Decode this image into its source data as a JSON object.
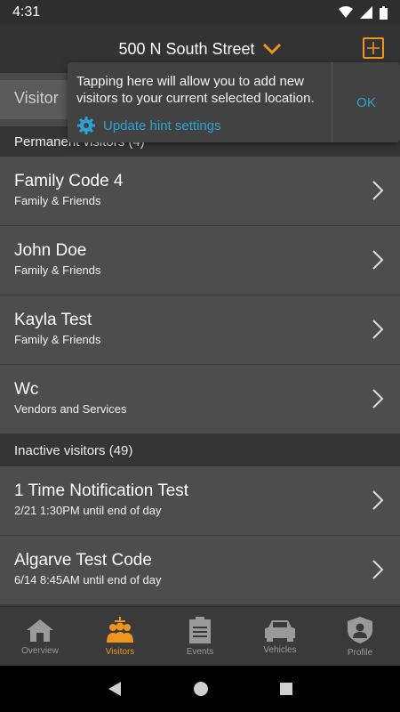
{
  "status": {
    "time": "4:31"
  },
  "header": {
    "location": "500 N South Street"
  },
  "search": {
    "placeholder_partial": "Visitor"
  },
  "tooltip": {
    "text": "Tapping here will allow you to add new visitors to your current selected location.",
    "link": "Update hint settings",
    "ok": "OK"
  },
  "sections": {
    "permanent": "Permanent visitors (4)",
    "inactive": "Inactive visitors (49)"
  },
  "permanent_rows": [
    {
      "title": "Family Code 4",
      "subtitle": "Family & Friends"
    },
    {
      "title": "John Doe",
      "subtitle": "Family & Friends"
    },
    {
      "title": "Kayla Test",
      "subtitle": "Family & Friends"
    },
    {
      "title": "Wc",
      "subtitle": "Vendors and Services"
    }
  ],
  "inactive_rows": [
    {
      "title": "1 Time Notification Test",
      "subtitle": "2/21 1:30PM until end of day"
    },
    {
      "title": "Algarve Test Code",
      "subtitle": "6/14 8:45AM until end of day"
    }
  ],
  "tabs": [
    {
      "label": "Overview",
      "icon": "house-icon"
    },
    {
      "label": "Visitors",
      "icon": "people-icon"
    },
    {
      "label": "Events",
      "icon": "clipboard-icon"
    },
    {
      "label": "Vehicles",
      "icon": "car-icon"
    },
    {
      "label": "Profile",
      "icon": "shield-person-icon"
    }
  ],
  "colors": {
    "accent": "#f0941f",
    "link": "#2ba3d6"
  }
}
